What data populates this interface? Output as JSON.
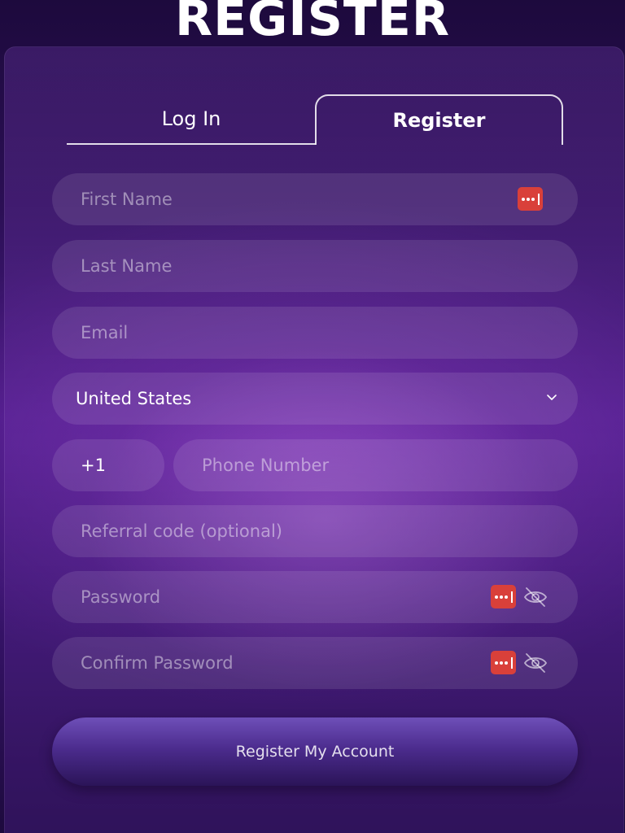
{
  "header": {
    "title": "REGISTER"
  },
  "tabs": [
    {
      "label": "Log In",
      "active": false
    },
    {
      "label": "Register",
      "active": true
    }
  ],
  "form": {
    "first_name": {
      "placeholder": "First Name",
      "value": ""
    },
    "last_name": {
      "placeholder": "Last Name",
      "value": ""
    },
    "email": {
      "placeholder": "Email",
      "value": ""
    },
    "country": {
      "value": "United States"
    },
    "phone_code": {
      "value": "+1"
    },
    "phone": {
      "placeholder": "Phone Number",
      "value": ""
    },
    "referral": {
      "placeholder": "Referral code (optional)",
      "value": ""
    },
    "password": {
      "placeholder": "Password",
      "value": ""
    },
    "confirm_password": {
      "placeholder": "Confirm Password",
      "value": ""
    }
  },
  "submit": {
    "label": "Register My Account"
  },
  "icons": {
    "password_manager": "password-manager-icon",
    "visibility": "eye-slash-icon",
    "dropdown": "chevron-down-icon"
  },
  "colors": {
    "password_manager_badge": "#d9403a",
    "text": "#ffffff"
  }
}
